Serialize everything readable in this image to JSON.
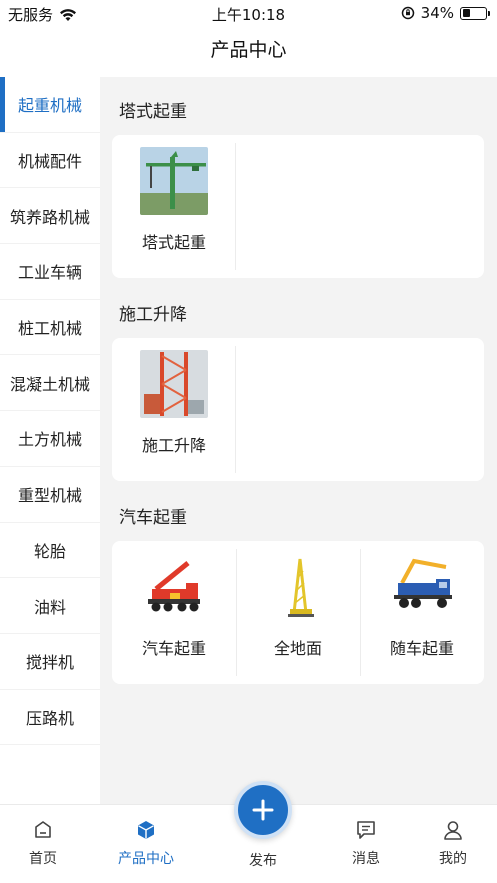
{
  "status_bar": {
    "carrier": "无服务",
    "time": "上午10:18",
    "battery": "34%",
    "battery_level": 0.34
  },
  "nav": {
    "title": "产品中心"
  },
  "sidebar": {
    "items": [
      {
        "label": "起重机械"
      },
      {
        "label": "机械配件"
      },
      {
        "label": "筑养路机械"
      },
      {
        "label": "工业车辆"
      },
      {
        "label": "桩工机械"
      },
      {
        "label": "混凝土机械"
      },
      {
        "label": "土方机械"
      },
      {
        "label": "重型机械"
      },
      {
        "label": "轮胎"
      },
      {
        "label": "油料"
      },
      {
        "label": "搅拌机"
      },
      {
        "label": "压路机"
      }
    ]
  },
  "sections": [
    {
      "title": "塔式起重",
      "items": [
        {
          "label": "塔式起重",
          "image": "tower-crane-photo"
        }
      ]
    },
    {
      "title": "施工升降",
      "items": [
        {
          "label": "施工升降",
          "image": "construction-hoist-photo"
        }
      ]
    },
    {
      "title": "汽车起重",
      "items": [
        {
          "label": "汽车起重",
          "image": "truck-crane-photo"
        },
        {
          "label": "全地面",
          "image": "all-terrain-crane-photo"
        },
        {
          "label": "随车起重",
          "image": "truck-mounted-crane-photo"
        }
      ]
    }
  ],
  "tab_bar": {
    "home": "首页",
    "products": "产品中心",
    "publish": "发布",
    "messages": "消息",
    "mine": "我的"
  },
  "colors": {
    "accent": "#1f6fc4",
    "background": "#f3f3f3"
  }
}
